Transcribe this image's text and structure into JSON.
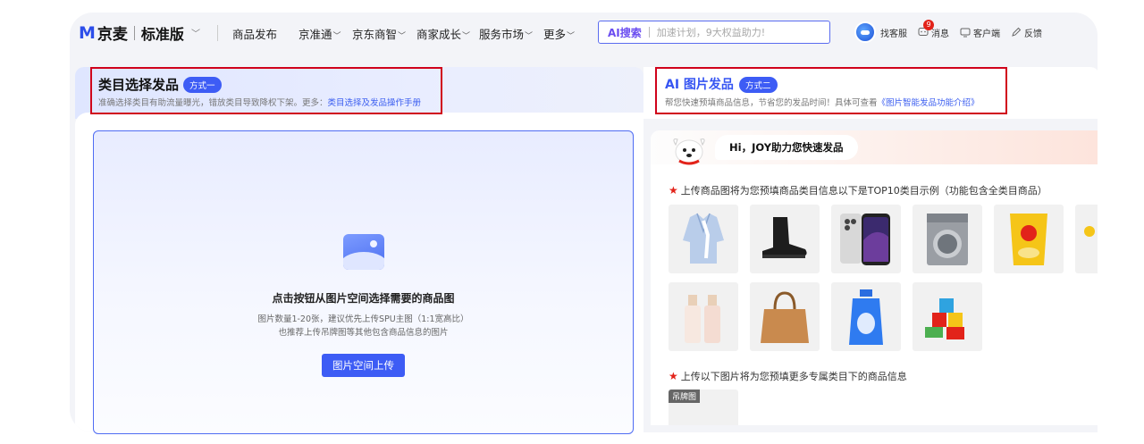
{
  "header": {
    "logo_mark": "M",
    "logo_text": "京麦",
    "edition": "标准版",
    "nav": [
      {
        "label": "商品发布",
        "chevron": false
      },
      {
        "label": "京准通",
        "chevron": true
      },
      {
        "label": "京东商智",
        "chevron": true
      },
      {
        "label": "商家成长",
        "chevron": true
      },
      {
        "label": "服务市场",
        "chevron": true
      },
      {
        "label": "更多",
        "chevron": true
      }
    ],
    "search": {
      "ai_label": "AI搜索",
      "placeholder": "加速计划，9大权益助力!"
    },
    "tools": {
      "customer_service": "找客服",
      "messages": "消息",
      "message_count": "9",
      "client": "客户端",
      "feedback": "反馈"
    }
  },
  "left_section": {
    "title": "类目选择发品",
    "pill": "方式一",
    "desc": "准确选择类目有助流量曝光，错放类目导致降权下架。更多：",
    "link": "类目选择及发品操作手册"
  },
  "right_section": {
    "ai_title": "AI 图片发品",
    "pill": "方式二",
    "desc": "帮您快速预填商品信息，节省您的发品时间！具体可查看",
    "link": "《图片智能发品功能介绍》"
  },
  "upload": {
    "title": "点击按钮从图片空间选择需要的商品图",
    "desc1": "图片数量1-20张，建议优先上传SPU主图（1:1宽高比）",
    "desc2": "也推荐上传吊牌图等其他包含商品信息的图片",
    "button": "图片空间上传"
  },
  "assistant": {
    "greeting": "Hi，JOY助力您快速发品",
    "tip1": "上传商品图将为您预填商品类目信息以下是TOP10类目示例（功能包含全类目商品）",
    "tip2": "上传以下图片将为您预填更多专属类目下的商品信息",
    "hang_tag": "吊牌图"
  },
  "colors": {
    "brand_red": "#e2231a",
    "primary_blue": "#3d5cf5",
    "highlight_red": "#d0021b"
  }
}
